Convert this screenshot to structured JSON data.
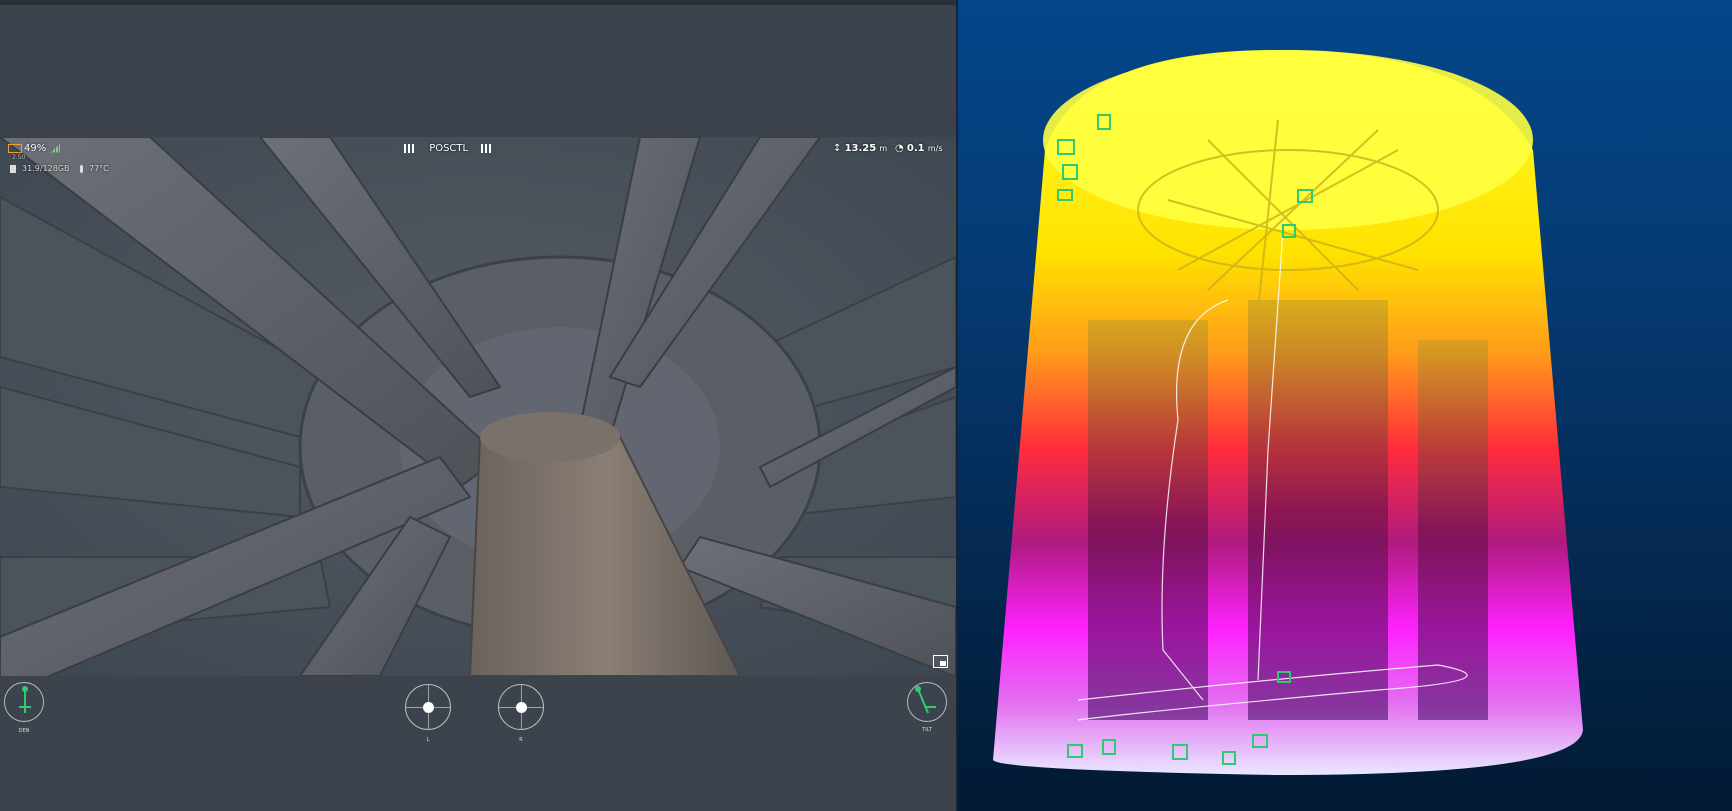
{
  "hud": {
    "battery_percent": "49%",
    "battery_sub": "2.50",
    "storage": "31.9/128GB",
    "temperature": "77°C",
    "flight_mode": "POSCTL",
    "altitude_value": "13.25",
    "altitude_unit": "m",
    "speed_value": "0.1",
    "speed_unit": "m/s"
  },
  "controls": {
    "left_gauge_label": "DEN",
    "left_stick_label": "L",
    "right_stick_label": "R",
    "tilt_gauge_label": "TILT"
  },
  "colors": {
    "panel_bg": "#3d434d",
    "accent_green": "#2ecc71",
    "pointcloud_top": "#ffff00",
    "pointcloud_mid": "#ff2a2a",
    "pointcloud_bottom": "#ff00ff"
  },
  "icons": [
    "battery-icon",
    "signal-icon",
    "sd-card-icon",
    "thermometer-icon",
    "altitude-icon",
    "speedometer-icon",
    "pip-toggle-icon"
  ]
}
